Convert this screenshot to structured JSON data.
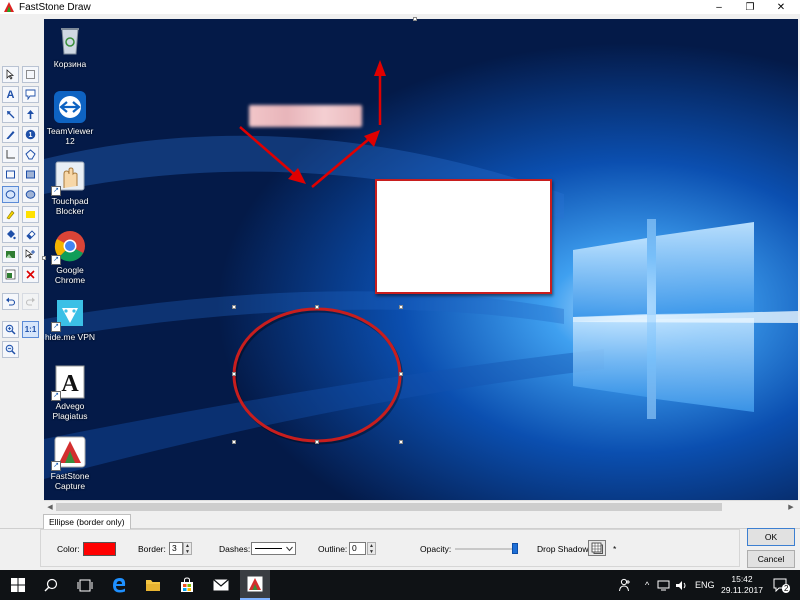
{
  "app": {
    "title": "FastStone Draw",
    "window_buttons": [
      "–",
      "❐",
      "✕"
    ]
  },
  "toolbox": {
    "tools": [
      {
        "name": "select-arrow-tool",
        "icon": "cursor-arrow"
      },
      {
        "name": "select-rect-tool",
        "icon": "dotted-rectangle"
      },
      {
        "name": "text-tool",
        "icon": "letter-a",
        "glyph": "A"
      },
      {
        "name": "callout-tool",
        "icon": "speech-balloon"
      },
      {
        "name": "arrow-line-tool",
        "icon": "diagonal-arrow"
      },
      {
        "name": "arrow-up-tool",
        "icon": "up-arrow"
      },
      {
        "name": "pen-tool",
        "icon": "pen"
      },
      {
        "name": "number-step-tool",
        "icon": "numbered-circle",
        "glyph": "1"
      },
      {
        "name": "line-tool",
        "icon": "right-angle"
      },
      {
        "name": "polygon-tool",
        "icon": "polygon"
      },
      {
        "name": "rectangle-tool",
        "icon": "rectangle-outline"
      },
      {
        "name": "filled-rectangle-tool",
        "icon": "rectangle-filled"
      },
      {
        "name": "ellipse-tool",
        "icon": "ellipse-outline"
      },
      {
        "name": "filled-ellipse-tool",
        "icon": "ellipse-filled"
      },
      {
        "name": "highlighter-tool",
        "icon": "highlighter"
      },
      {
        "name": "highlight-rect-tool",
        "icon": "yellow-rectangle"
      },
      {
        "name": "fill-tool",
        "icon": "paint-bucket"
      },
      {
        "name": "eraser-tool",
        "icon": "eraser"
      },
      {
        "name": "insert-image-tool",
        "icon": "picture"
      },
      {
        "name": "add-pointer-tool",
        "icon": "cursor-plus"
      },
      {
        "name": "background-tool",
        "icon": "green-square"
      },
      {
        "name": "delete-tool",
        "icon": "red-x"
      },
      {
        "name": "undo-tool",
        "icon": "undo"
      },
      {
        "name": "redo-tool",
        "icon": "redo"
      },
      {
        "name": "zoom-in-tool",
        "icon": "magnifier-plus"
      },
      {
        "name": "actual-size-tool",
        "icon": "one-to-one",
        "glyph": "1:1"
      },
      {
        "name": "zoom-out-tool",
        "icon": "magnifier-minus"
      }
    ]
  },
  "desktop": {
    "icons": [
      {
        "label": "Корзина",
        "icon": "recycle-bin-icon"
      },
      {
        "label": "TeamViewer\n12",
        "icon": "teamviewer-icon"
      },
      {
        "label": "Touchpad\nBlocker",
        "icon": "touchpad-blocker-icon"
      },
      {
        "label": "Google\nChrome",
        "icon": "chrome-icon"
      },
      {
        "label": "hide.me VPN",
        "icon": "hideme-vpn-icon"
      },
      {
        "label": "Advego\nPlagiatus",
        "icon": "advego-icon"
      },
      {
        "label": "FastStone\nCapture",
        "icon": "faststone-capture-icon"
      }
    ]
  },
  "annotations": {
    "arrow_color": "#e00000",
    "ellipse_color": "#c81e1e",
    "rect_border_color": "#c81e1e"
  },
  "properties": {
    "tab_label": "Ellipse (border only)",
    "color_label": "Color:",
    "color_value": "#ff0000",
    "border_label": "Border:",
    "border_value": "3",
    "dashes_label": "Dashes:",
    "outline_label": "Outline:",
    "outline_value": "0",
    "opacity_label": "Opacity:",
    "opacity_value": 1.0,
    "drop_shadow_label": "Drop Shadow:",
    "drop_shadow_extra": "*"
  },
  "buttons": {
    "ok": "OK",
    "cancel": "Cancel"
  },
  "taskbar": {
    "lang": "ENG",
    "time": "15:42",
    "date": "29.11.2017",
    "notification_count": "2"
  }
}
